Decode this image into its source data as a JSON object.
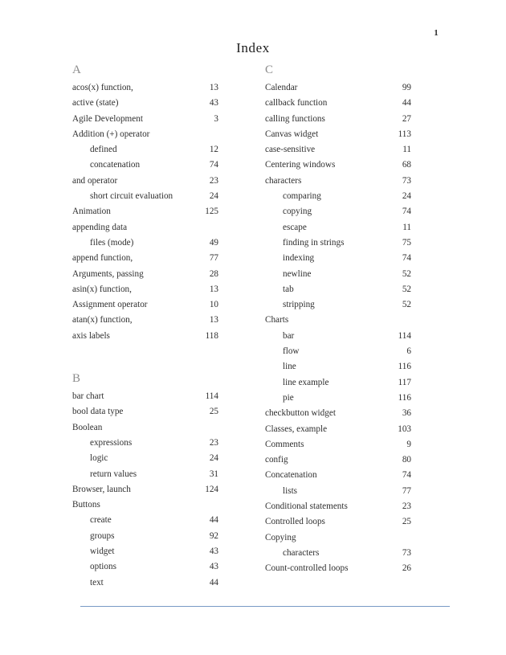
{
  "document": {
    "title": "Index",
    "page_number": "1",
    "rule_color": "#6a8fc0"
  },
  "columns": [
    {
      "id": "left",
      "sections": [
        {
          "letter": "A",
          "entries": [
            {
              "term": "acos(x) function,",
              "page": "13",
              "level": 0
            },
            {
              "term": "active (state)",
              "page": "43",
              "level": 0
            },
            {
              "term": "Agile Development",
              "page": "3",
              "level": 0
            },
            {
              "term": "Addition (+) operator",
              "page": "",
              "level": 0
            },
            {
              "term": "defined",
              "page": "12",
              "level": 1
            },
            {
              "term": "concatenation",
              "page": "74",
              "level": 1
            },
            {
              "term": "and operator",
              "page": "23",
              "level": 0
            },
            {
              "term": "short circuit evaluation",
              "page": "24",
              "level": 1
            },
            {
              "term": "Animation",
              "page": "125",
              "level": 0
            },
            {
              "term": "appending data",
              "page": "",
              "level": 0
            },
            {
              "term": "files (mode)",
              "page": "49",
              "level": 1
            },
            {
              "term": "append function,",
              "page": "77",
              "level": 0
            },
            {
              "term": "Arguments, passing",
              "page": "28",
              "level": 0
            },
            {
              "term": "asin(x) function,",
              "page": "13",
              "level": 0
            },
            {
              "term": "Assignment operator",
              "page": "10",
              "level": 0
            },
            {
              "term": "atan(x) function,",
              "page": "13",
              "level": 0
            },
            {
              "term": "axis labels",
              "page": "118",
              "level": 0
            }
          ]
        },
        {
          "letter": "B",
          "entries": [
            {
              "term": "bar chart",
              "page": "114",
              "level": 0
            },
            {
              "term": "bool data type",
              "page": "25",
              "level": 0
            },
            {
              "term": "Boolean",
              "page": "",
              "level": 0
            },
            {
              "term": "expressions",
              "page": "23",
              "level": 1
            },
            {
              "term": "logic",
              "page": "24",
              "level": 1
            },
            {
              "term": "return values",
              "page": "31",
              "level": 1
            },
            {
              "term": "Browser, launch",
              "page": "124",
              "level": 0
            },
            {
              "term": "Buttons",
              "page": "",
              "level": 0
            },
            {
              "term": "create",
              "page": "44",
              "level": 1
            },
            {
              "term": "groups",
              "page": "92",
              "level": 1
            },
            {
              "term": "widget",
              "page": "43",
              "level": 1
            },
            {
              "term": "options",
              "page": "43",
              "level": 1
            },
            {
              "term": "text",
              "page": "44",
              "level": 1
            }
          ]
        }
      ]
    },
    {
      "id": "right",
      "sections": [
        {
          "letter": "C",
          "entries": [
            {
              "term": "Calendar",
              "page": "99",
              "level": 0
            },
            {
              "term": "callback function",
              "page": "44",
              "level": 0
            },
            {
              "term": "calling functions",
              "page": "27",
              "level": 0
            },
            {
              "term": "Canvas widget",
              "page": "113",
              "level": 0
            },
            {
              "term": "case-sensitive",
              "page": "11",
              "level": 0
            },
            {
              "term": "Centering windows",
              "page": "68",
              "level": 0
            },
            {
              "term": "characters",
              "page": "73",
              "level": 0
            },
            {
              "term": "comparing",
              "page": "24",
              "level": 1
            },
            {
              "term": "copying",
              "page": "74",
              "level": 1
            },
            {
              "term": "escape",
              "page": "11",
              "level": 1
            },
            {
              "term": "finding in strings",
              "page": "75",
              "level": 1
            },
            {
              "term": "indexing",
              "page": "74",
              "level": 1
            },
            {
              "term": "newline",
              "page": "52",
              "level": 1
            },
            {
              "term": "tab",
              "page": "52",
              "level": 1
            },
            {
              "term": "stripping",
              "page": "52",
              "level": 1
            },
            {
              "term": "Charts",
              "page": "",
              "level": 0
            },
            {
              "term": "bar",
              "page": "114",
              "level": 1
            },
            {
              "term": "flow",
              "page": "6",
              "level": 1
            },
            {
              "term": "line",
              "page": "116",
              "level": 1
            },
            {
              "term": "line example",
              "page": "117",
              "level": 1
            },
            {
              "term": "pie",
              "page": "116",
              "level": 1
            },
            {
              "term": "checkbutton widget",
              "page": "36",
              "level": 0
            },
            {
              "term": "Classes, example",
              "page": "103",
              "level": 0
            },
            {
              "term": "Comments",
              "page": "9",
              "level": 0
            },
            {
              "term": "config",
              "page": "80",
              "level": 0
            },
            {
              "term": "Concatenation",
              "page": "74",
              "level": 0
            },
            {
              "term": "lists",
              "page": "77",
              "level": 1
            },
            {
              "term": "Conditional statements",
              "page": "23",
              "level": 0
            },
            {
              "term": "Controlled loops",
              "page": "25",
              "level": 0
            },
            {
              "term": "Copying",
              "page": "",
              "level": 0
            },
            {
              "term": "characters",
              "page": "73",
              "level": 1
            },
            {
              "term": "Count-controlled loops",
              "page": "26",
              "level": 0
            }
          ]
        }
      ]
    }
  ]
}
